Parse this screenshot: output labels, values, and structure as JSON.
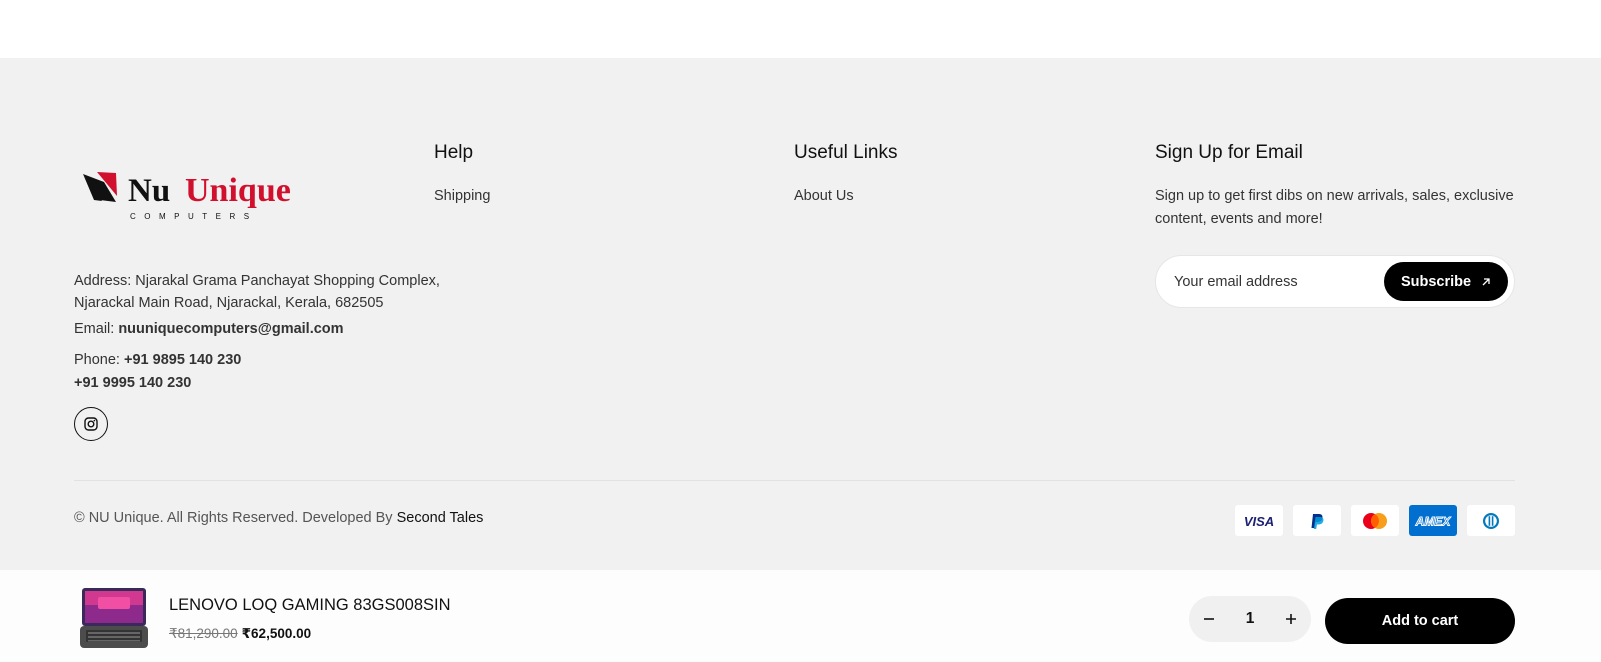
{
  "brand": {
    "name_left": "Nu",
    "name_right": "Unique",
    "tagline": "COMPUTERS",
    "accent_color": "#d0102c"
  },
  "footer": {
    "columns": [
      {
        "title": "Help",
        "links": [
          "Shipping"
        ]
      },
      {
        "title": "Useful Links",
        "links": [
          "About Us"
        ]
      },
      {
        "title": "Sign Up for Email"
      }
    ],
    "contact": {
      "address_line1": "Address: Njarakal Grama Panchayat Shopping Complex,",
      "address_line2": "Njarackal Main Road, Njarackal, Kerala, 682505",
      "email_label": "Email: ",
      "email": "nuuniquecomputers@gmail.com",
      "phone_label": "Phone: ",
      "phone1": "+91 9895 140 230",
      "phone2": "+91 9995 140 230"
    },
    "social": {
      "icon": "instagram-icon"
    },
    "newsletter": {
      "text": "Sign up to get first dibs on new arrivals, sales, exclusive content, events and more!",
      "placeholder": "Your email address",
      "button_label": "Subscribe"
    },
    "copyright_prefix": "© NU Unique. All Rights Reserved. Developed By ",
    "copyright_link": "Second Tales",
    "payments": [
      "VISA",
      "PayPal",
      "Mastercard",
      "AMEX",
      "Diners Club"
    ]
  },
  "sticky_cart": {
    "product_name": "LENOVO LOQ GAMING 83GS008SIN",
    "old_price": "₹81,290.00",
    "new_price": "₹62,500.00",
    "quantity": "1",
    "button_label": "Add to cart"
  }
}
